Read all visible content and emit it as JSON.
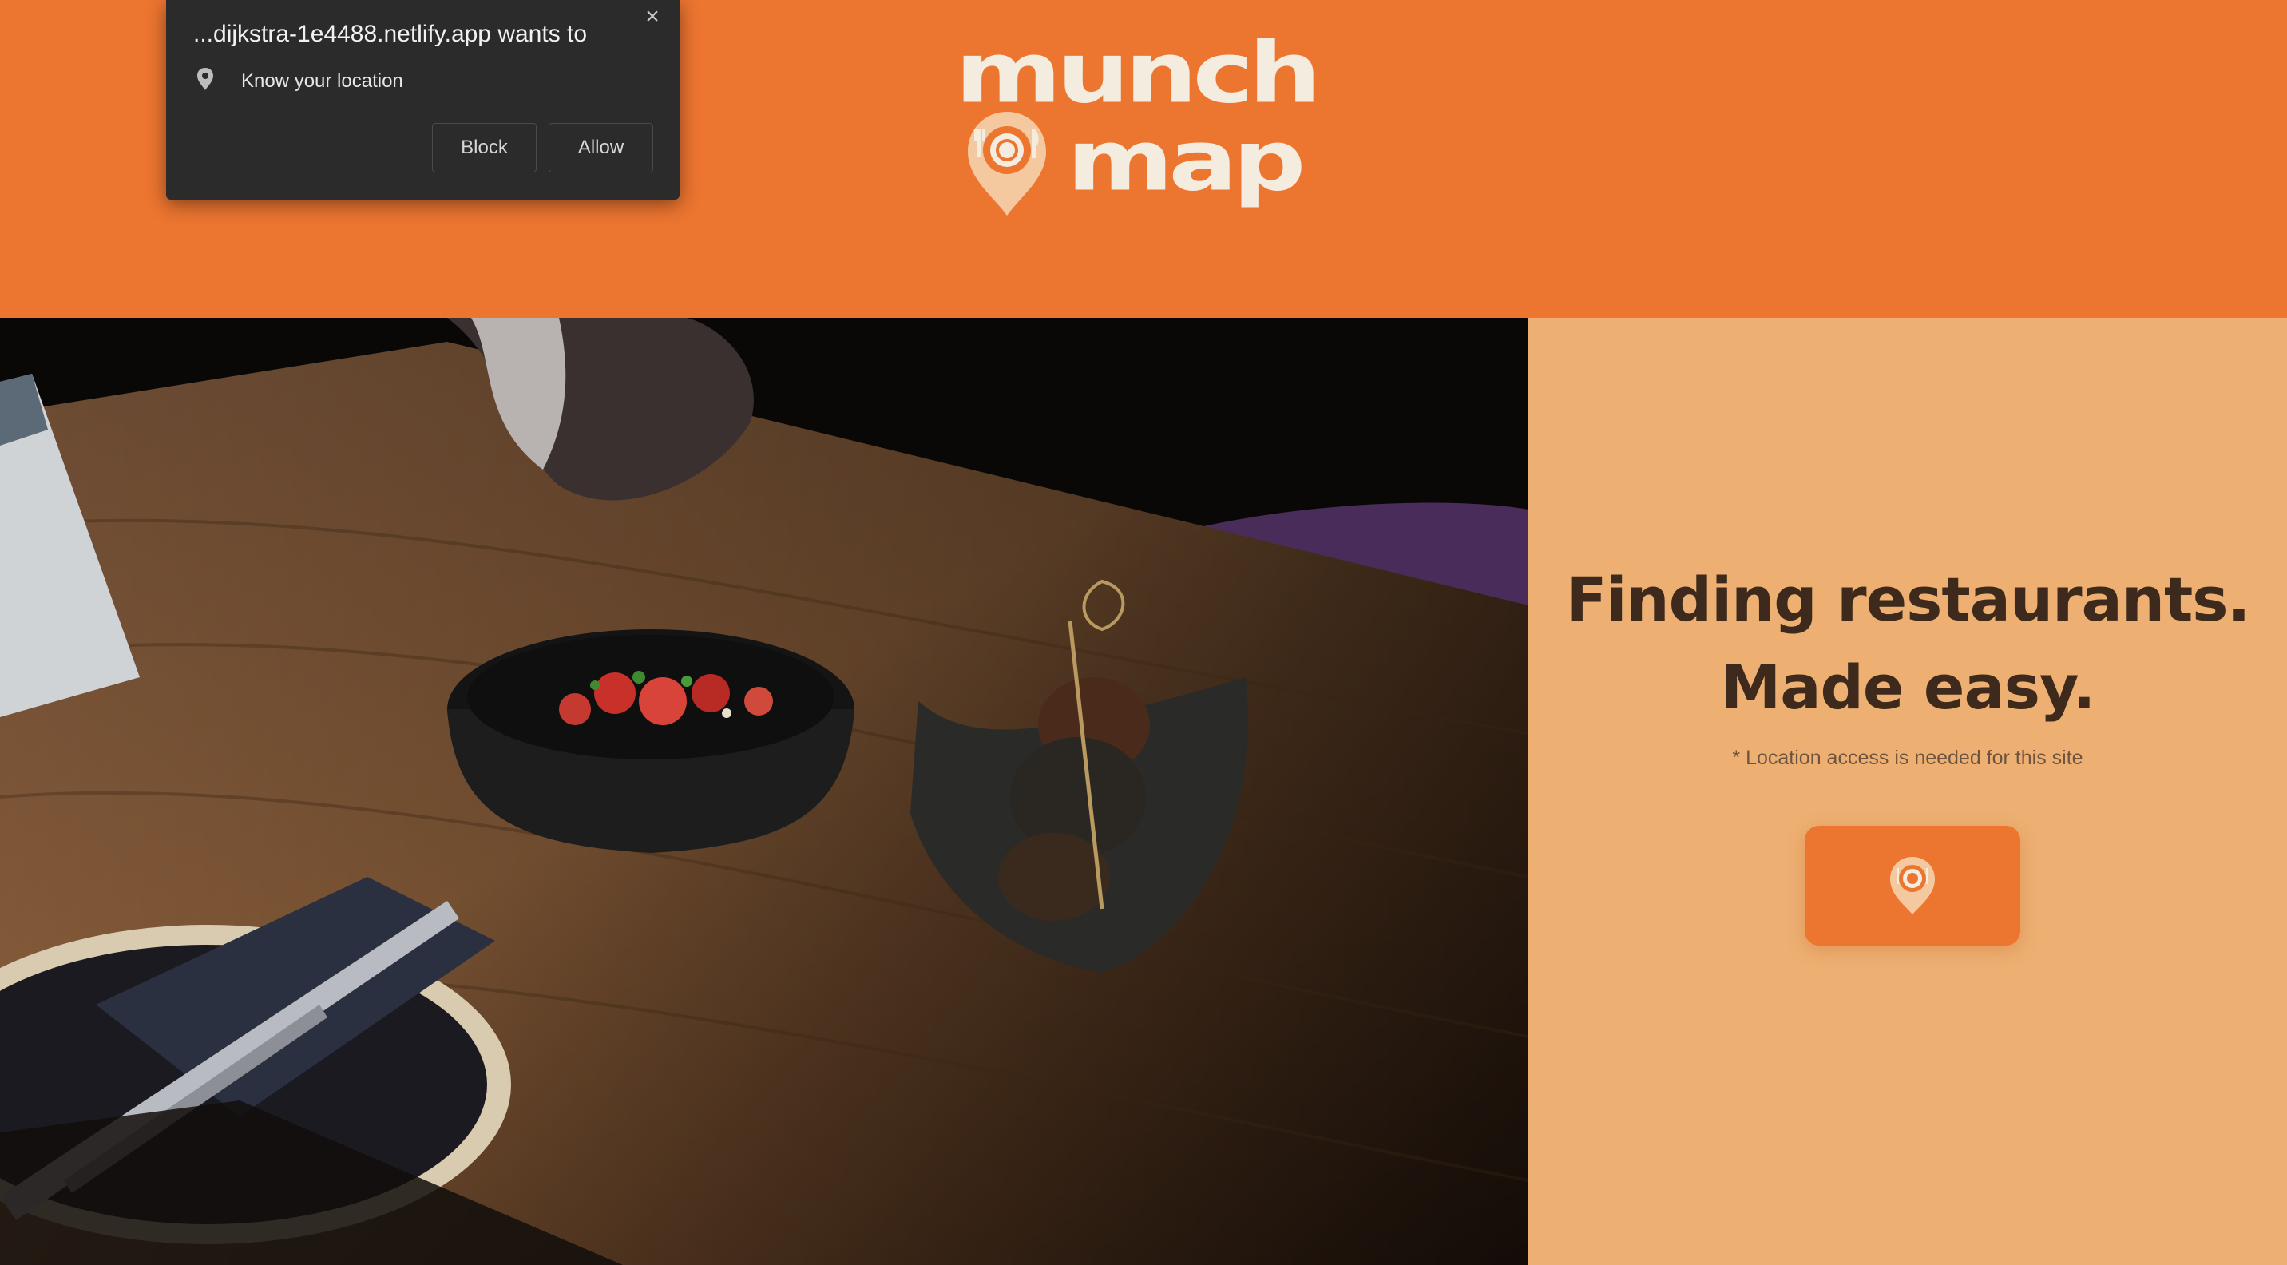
{
  "header": {
    "logo_line1": "munch",
    "logo_line2": "map"
  },
  "hero": {
    "headline_line1": "Finding restaurants.",
    "headline_line2": "Made easy.",
    "note": "* Location access is needed for this site",
    "locate_button_icon": "location-pin-plate-icon"
  },
  "permission_popup": {
    "title": "...dijkstra-1e4488.netlify.app wants to",
    "permission": "Know your location",
    "block_label": "Block",
    "allow_label": "Allow",
    "close_icon": "close-icon",
    "permission_icon": "location-pin-icon"
  },
  "colors": {
    "brand_orange": "#ec7530",
    "panel_peach": "#edb072",
    "headline_brown": "#3d2a1c",
    "logo_cream": "#f4ecdf",
    "popup_bg": "#2b2b2b"
  }
}
